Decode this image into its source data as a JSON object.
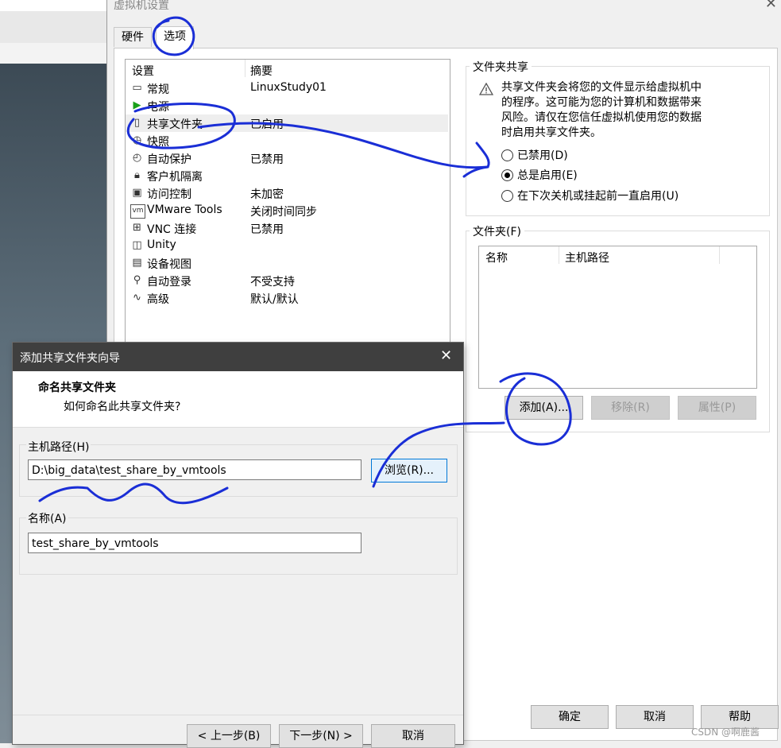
{
  "main_dialog": {
    "title": "虚拟机设置",
    "close": "✕",
    "tabs": [
      {
        "label": "硬件",
        "active": false
      },
      {
        "label": "选项",
        "active": true
      }
    ]
  },
  "settings": {
    "col_setting": "设置",
    "col_summary": "摘要",
    "items": [
      {
        "icon": "general-icon",
        "name": "常规",
        "value": "LinuxStudy01"
      },
      {
        "icon": "power-icon",
        "name": "电源",
        "value": ""
      },
      {
        "icon": "shared-folder-icon",
        "name": "共享文件夹",
        "value": "已启用",
        "selected": true
      },
      {
        "icon": "snapshot-icon",
        "name": "快照",
        "value": ""
      },
      {
        "icon": "autoprotect-icon",
        "name": "自动保护",
        "value": "已禁用"
      },
      {
        "icon": "lock-icon",
        "name": "客户机隔离",
        "value": ""
      },
      {
        "icon": "access-control-icon",
        "name": "访问控制",
        "value": "未加密"
      },
      {
        "icon": "vmware-tools-icon",
        "name": "VMware Tools",
        "value": "关闭时间同步"
      },
      {
        "icon": "vnc-icon",
        "name": "VNC 连接",
        "value": "已禁用"
      },
      {
        "icon": "unity-icon",
        "name": "Unity",
        "value": ""
      },
      {
        "icon": "device-view-icon",
        "name": "设备视图",
        "value": ""
      },
      {
        "icon": "autologin-icon",
        "name": "自动登录",
        "value": "不受支持"
      },
      {
        "icon": "advanced-icon",
        "name": "高级",
        "value": "默认/默认"
      }
    ]
  },
  "folder_sharing": {
    "group_title": "文件夹共享",
    "warning_lines": [
      "共享文件夹会将您的文件显示给虚拟机中",
      "的程序。这可能为您的计算机和数据带来",
      "风险。请仅在您信任虚拟机使用您的数据",
      "时启用共享文件夹。"
    ],
    "options": [
      {
        "label": "已禁用(D)",
        "checked": false
      },
      {
        "label": "总是启用(E)",
        "checked": true
      },
      {
        "label": "在下次关机或挂起前一直启用(U)",
        "checked": false
      }
    ]
  },
  "folders": {
    "group_title": "文件夹(F)",
    "col_name": "名称",
    "col_host_path": "主机路径",
    "add_button": "添加(A)...",
    "remove_button": "移除(R)",
    "properties_button": "属性(P)"
  },
  "footer": {
    "ok": "确定",
    "cancel": "取消",
    "help": "帮助"
  },
  "wizard": {
    "title": "添加共享文件夹向导",
    "close": "✕",
    "heading": "命名共享文件夹",
    "subheading": "如何命名此共享文件夹?",
    "host_path_label": "主机路径(H)",
    "host_path_value": "D:\\big_data\\test_share_by_vmtools",
    "browse_button": "浏览(R)...",
    "name_label": "名称(A)",
    "name_value": "test_share_by_vmtools",
    "back_button": "< 上一步(B)",
    "next_button": "下一步(N) >",
    "cancel_button": "取消"
  },
  "watermark": "CSDN @啊鹿酱",
  "colors": {
    "annotation": "#1a2ed6",
    "wizard_titlebar": "#3f3f3f",
    "accent": "#0078d7"
  }
}
